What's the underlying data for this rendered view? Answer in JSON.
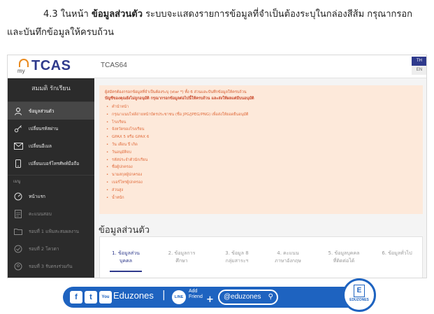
{
  "caption": {
    "part1": "4.3 ในหน้า ",
    "bold": "ข้อมูลส่วนตัว",
    "part2": " ระบบจะแสดงรายการข้อมูลที่จำเป็นต้องระบุในกล่องสีส้ม กรุณากรอก",
    "line2": "และบันทึกข้อมูลให้ครบถ้วน"
  },
  "app": {
    "logo_prefix": "my",
    "logo_word": "TCAS",
    "code": "TCAS64",
    "lang_th": "TH",
    "lang_en": "EN"
  },
  "sidebar": {
    "user_name": "สมมติ รักเรียน",
    "items": [
      {
        "label": "ข้อมูลส่วนตัว",
        "icon": "person-icon"
      },
      {
        "label": "เปลี่ยนรหัสผ่าน",
        "icon": "key-icon"
      },
      {
        "label": "เปลี่ยนอีเมล",
        "icon": "mail-icon"
      },
      {
        "label": "เปลี่ยนเบอร์โทรศัพท์มือถือ",
        "icon": "phone-icon"
      }
    ],
    "section_label": "เมนู",
    "menu_items": [
      {
        "label": "หน้าแรก",
        "icon": "dashboard-icon"
      },
      {
        "label": "คะแนนสอบ",
        "icon": "document-icon"
      },
      {
        "label": "รอบที่ 1 แฟ้มสะสมผลงาน",
        "icon": "folder-icon"
      },
      {
        "label": "รอบที่ 2 โควตา",
        "icon": "quota-icon"
      },
      {
        "label": "รอบที่ 3 รับตรงร่วมกัน",
        "icon": "people-icon"
      }
    ]
  },
  "notice": {
    "line1": "ผู้สมัครต้องกรอกข้อมูลที่จำเป็นต้องระบุ (star *) ทั้ง 6 ส่วนและบันทึกข้อมูลให้ครบถ้วน",
    "line2": "บัญชีของคุณยังไม่ถูกอนุมัติ กรุณากรอกข้อมูลต่อไปนี้ให้ครบถ้วน และส่งให้ผลแต่มีบนอนุมัติ",
    "items": [
      "คำนำหน้า",
      "กรุณาแนบไฟล์ถ่ายหน้าบัตรประชาชน (ชื่อ JPG/JPEG/PNG) เพื่อส่งให้ยอดยืนอนุมัติ",
      "โรงเรียน",
      "จังหวัดของโรงเรียน",
      "GPAX 5 หรือ GPAX 6",
      "วัน เดือน ปี เกิด",
      "วันอนุมัติจบ",
      "รหัสประจำตัวนักเรียน",
      "ชื่อผู้ปกครอง",
      "นามสกุลผู้ปกครอง",
      "เบอร์โทรผู้ปกครอง",
      "ส่วนสูง",
      "น้ำหนัก"
    ]
  },
  "main": {
    "section_title": "ข้อมูลส่วนตัว",
    "steps": [
      {
        "line1": "1. ข้อมูลส่วน",
        "line2": "บุคคล"
      },
      {
        "line1": "2. ข้อมูลการ",
        "line2": "ศึกษา"
      },
      {
        "line1": "3. ข้อมูล 8",
        "line2": "กลุ่มสาระฯ"
      },
      {
        "line1": "4. คะแนน",
        "line2": "ภาษาอังกฤษ"
      },
      {
        "line1": "5. ข้อมูลบุคคล",
        "line2": "ที่ติดต่อได้"
      },
      {
        "line1": "6. ข้อมูลทั่วไป",
        "line2": ""
      }
    ]
  },
  "banner": {
    "brand": "Eduzones",
    "separator": "|",
    "line_label": "LINE",
    "add_label": "Add",
    "friend_label": "Friend",
    "handle": "@eduzones",
    "logo_letter": "E",
    "logo_text": "EDUZONES",
    "social_f": "f",
    "social_t": "t",
    "social_y": "You",
    "colors": {
      "blue": "#1e63c0",
      "orange": "#e06a3a",
      "navy": "#2f3a8c"
    }
  }
}
